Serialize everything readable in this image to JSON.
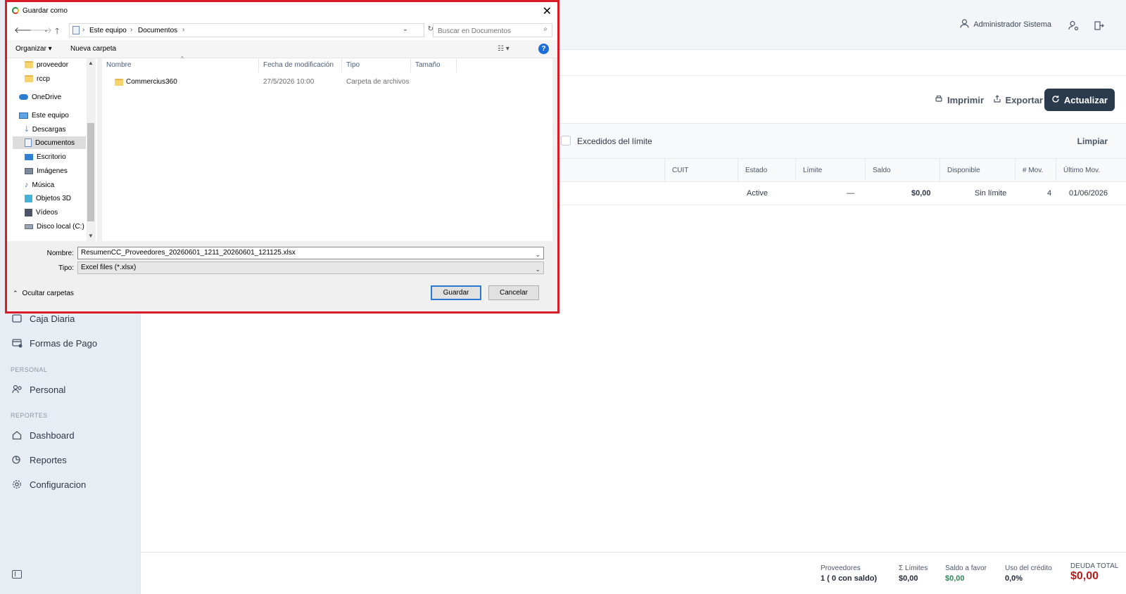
{
  "sidebar": {
    "items_top": [
      {
        "label": "Caja Diaria",
        "icon": "cash-register-icon"
      },
      {
        "label": "Formas de Pago",
        "icon": "payment-methods-icon"
      }
    ],
    "section_personal": "PERSONAL",
    "personal_item": "Personal",
    "section_reportes": "REPORTES",
    "report_items": [
      "Dashboard",
      "Reportes",
      "Configuracion"
    ]
  },
  "header": {
    "user_name": "Administrador Sistema"
  },
  "toolbar": {
    "print_label": "Imprimir",
    "export_label": "Exportar",
    "refresh_label": "Actualizar"
  },
  "filters": {
    "exceeded_label": "Excedidos del límite",
    "clear_label": "Limpiar"
  },
  "table": {
    "columns": [
      "CUIT",
      "Estado",
      "Límite",
      "Saldo",
      "Disponible",
      "# Mov.",
      "Último Mov."
    ],
    "rows": [
      {
        "cuit": "",
        "estado": "Active",
        "limite": "—",
        "saldo": "$0,00",
        "disponible": "Sin límite",
        "mov": "4",
        "ultimo": "01/06/2026"
      }
    ]
  },
  "footer": {
    "proveedores_label": "Proveedores",
    "proveedores_value": "1 ( 0  con saldo)",
    "limites_label": "Σ Límites",
    "limites_value": "$0,00",
    "saldo_favor_label": "Saldo a favor",
    "saldo_favor_value": "$0,00",
    "uso_credito_label": "Uso del crédito",
    "uso_credito_value": "0,0%",
    "deuda_label": "DEUDA TOTAL",
    "deuda_value": "$0,00"
  },
  "dialog": {
    "title": "Guardar como",
    "breadcrumb": [
      "Este equipo",
      "Documentos"
    ],
    "search_placeholder": "Buscar en Documentos",
    "organize_label": "Organizar",
    "new_folder_label": "Nueva carpeta",
    "tree": [
      {
        "label": "proveedor",
        "icon": "folder-icon"
      },
      {
        "label": "rccp",
        "icon": "folder-icon"
      },
      {
        "label": "OneDrive",
        "icon": "cloud-icon"
      },
      {
        "label": "Este equipo",
        "icon": "computer-icon"
      },
      {
        "label": "Descargas",
        "icon": "download-icon"
      },
      {
        "label": "Documentos",
        "icon": "document-icon"
      },
      {
        "label": "Escritorio",
        "icon": "desktop-icon"
      },
      {
        "label": "Imágenes",
        "icon": "image-icon"
      },
      {
        "label": "Música",
        "icon": "music-icon"
      },
      {
        "label": "Objetos 3D",
        "icon": "cube-icon"
      },
      {
        "label": "Vídeos",
        "icon": "video-icon"
      },
      {
        "label": "Disco local (C:)",
        "icon": "drive-icon"
      }
    ],
    "columns": [
      "Nombre",
      "Fecha de modificación",
      "Tipo",
      "Tamaño"
    ],
    "files": [
      {
        "name": "Commercius360",
        "date": "27/5/2026 10:00",
        "type": "Carpeta de archivos",
        "size": ""
      }
    ],
    "filename_label": "Nombre:",
    "filename_value": "ResumenCC_Proveedores_20260601_1211_20260601_121125.xlsx",
    "type_label": "Tipo:",
    "type_value": "Excel files (*.xlsx)",
    "hide_folders_label": "Ocultar carpetas",
    "save_label": "Guardar",
    "cancel_label": "Cancelar"
  }
}
